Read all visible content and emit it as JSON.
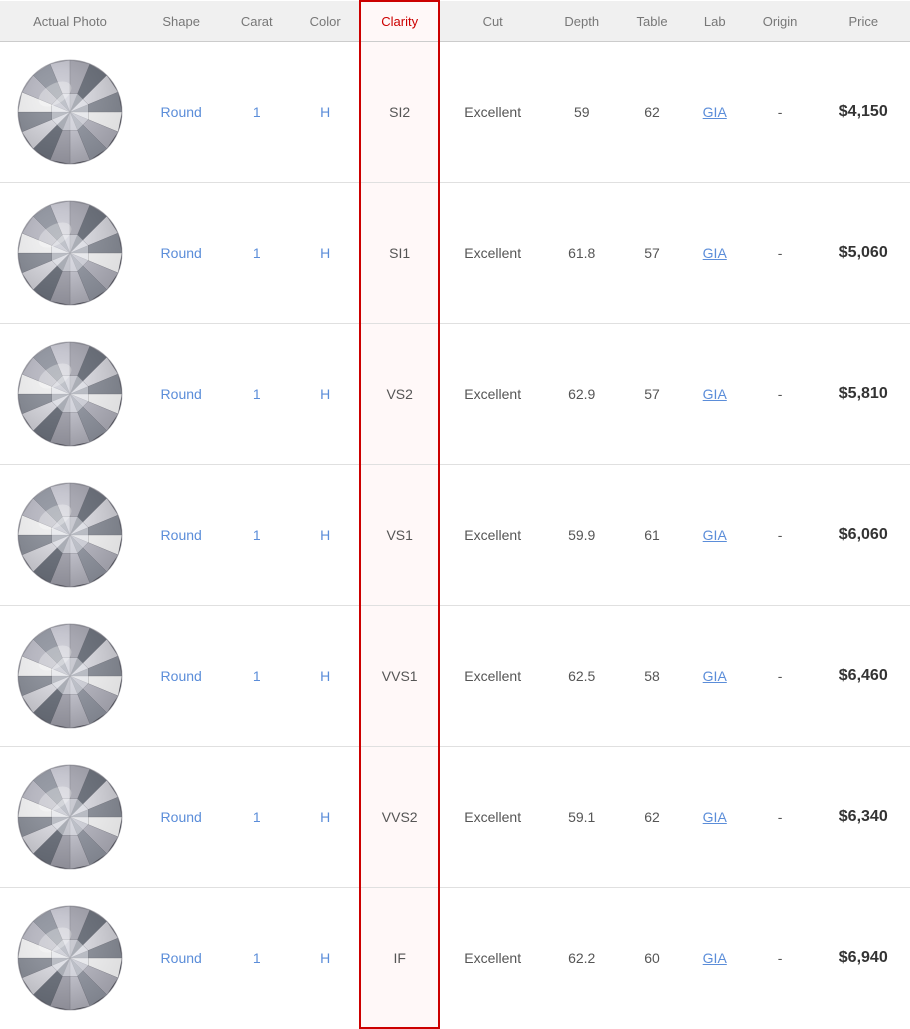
{
  "columns": {
    "actual_photo": "Actual Photo",
    "shape": "Shape",
    "carat": "Carat",
    "color": "Color",
    "clarity": "Clarity",
    "cut": "Cut",
    "depth": "Depth",
    "table": "Table",
    "lab": "Lab",
    "origin": "Origin",
    "price": "Price"
  },
  "rows": [
    {
      "id": 1,
      "shape": "Round",
      "carat": "1",
      "color": "H",
      "clarity": "SI2",
      "cut": "Excellent",
      "depth": "59",
      "table": "62",
      "lab": "GIA",
      "origin": "-",
      "price": "$4,150"
    },
    {
      "id": 2,
      "shape": "Round",
      "carat": "1",
      "color": "H",
      "clarity": "SI1",
      "cut": "Excellent",
      "depth": "61.8",
      "table": "57",
      "lab": "GIA",
      "origin": "-",
      "price": "$5,060"
    },
    {
      "id": 3,
      "shape": "Round",
      "carat": "1",
      "color": "H",
      "clarity": "VS2",
      "cut": "Excellent",
      "depth": "62.9",
      "table": "57",
      "lab": "GIA",
      "origin": "-",
      "price": "$5,810"
    },
    {
      "id": 4,
      "shape": "Round",
      "carat": "1",
      "color": "H",
      "clarity": "VS1",
      "cut": "Excellent",
      "depth": "59.9",
      "table": "61",
      "lab": "GIA",
      "origin": "-",
      "price": "$6,060"
    },
    {
      "id": 5,
      "shape": "Round",
      "carat": "1",
      "color": "H",
      "clarity": "VVS1",
      "cut": "Excellent",
      "depth": "62.5",
      "table": "58",
      "lab": "GIA",
      "origin": "-",
      "price": "$6,460"
    },
    {
      "id": 6,
      "shape": "Round",
      "carat": "1",
      "color": "H",
      "clarity": "VVS2",
      "cut": "Excellent",
      "depth": "59.1",
      "table": "62",
      "lab": "GIA",
      "origin": "-",
      "price": "$6,340"
    },
    {
      "id": 7,
      "shape": "Round",
      "carat": "1",
      "color": "H",
      "clarity": "IF",
      "cut": "Excellent",
      "depth": "62.2",
      "table": "60",
      "lab": "GIA",
      "origin": "-",
      "price": "$6,940"
    }
  ],
  "accent_color": "#cc0000",
  "link_color": "#5b8dd9"
}
